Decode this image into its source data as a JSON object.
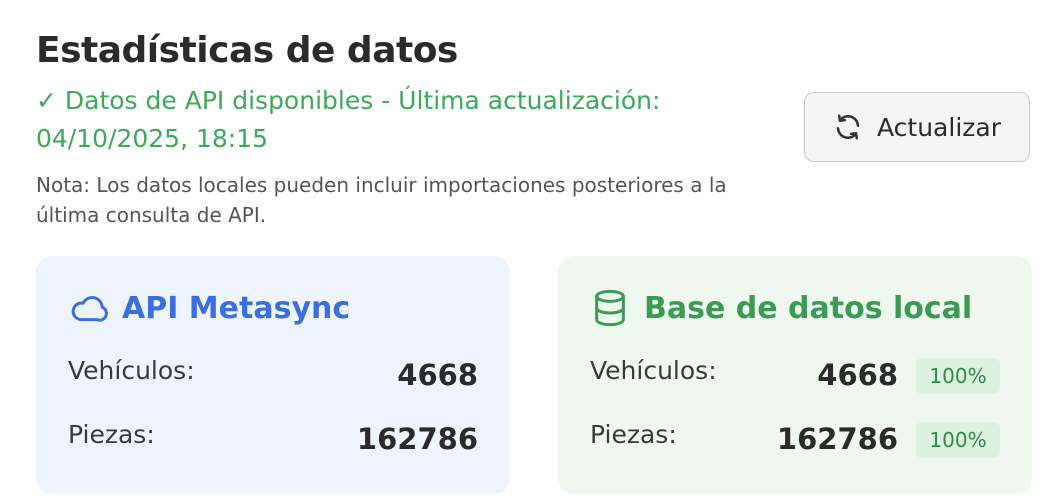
{
  "header": {
    "title": "Estadísticas de datos",
    "status": "✓ Datos de API disponibles - Última actualización: 04/10/2025, 18:15",
    "note": "Nota: Los datos locales pueden incluir importaciones posteriores a la última consulta de API.",
    "refresh_label": "Actualizar",
    "refresh_icon": "refresh-icon"
  },
  "api_card": {
    "title": "API Metasync",
    "icon": "cloud-icon",
    "vehicles_label": "Vehículos:",
    "vehicles_value": "4668",
    "parts_label": "Piezas:",
    "parts_value": "162786"
  },
  "local_card": {
    "title": "Base de datos local",
    "icon": "database-icon",
    "vehicles_label": "Vehículos:",
    "vehicles_value": "4668",
    "vehicles_percent": "100%",
    "parts_label": "Piezas:",
    "parts_value": "162786",
    "parts_percent": "100%"
  },
  "colors": {
    "status_green": "#3daa5a",
    "api_blue": "#3b6fe0",
    "local_green": "#3b9b55",
    "api_card_bg": "#eef4fd",
    "local_card_bg": "#eef8ef",
    "badge_bg": "#dcf2df"
  }
}
